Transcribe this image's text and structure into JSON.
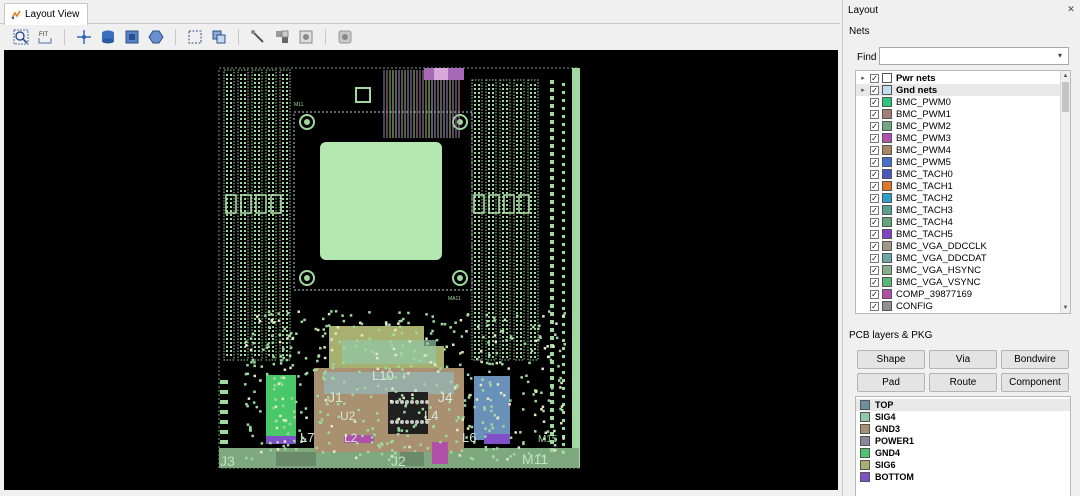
{
  "tab": {
    "label": "Layout View"
  },
  "toolbar": {
    "icons": [
      "zoom-area-icon",
      "zoom-fit-icon",
      "crosshair-icon",
      "cylinder-icon",
      "square-icon",
      "polygon-icon",
      "select-rect-icon",
      "layers-icon",
      "probe-icon",
      "stack-icon",
      "target-icon",
      "record-icon"
    ]
  },
  "board": {
    "labels": [
      "J3",
      "J2",
      "M11",
      "M11",
      "MA11",
      "J1",
      "J4",
      "L10",
      "L4",
      "L6",
      "L7",
      "L2",
      "U2",
      "M15"
    ]
  },
  "panel": {
    "title": "Layout",
    "close": "✕",
    "nets_title": "Nets",
    "find_label": "Find",
    "find_value": "",
    "find_drop": "▾",
    "nets": [
      {
        "name": "Pwr nets",
        "color": "#ffffff",
        "group": true,
        "checked": "✓",
        "expand": "▸"
      },
      {
        "name": "Gnd nets",
        "color": "#bfdcf0",
        "group": true,
        "checked": "✓",
        "expand": "▸"
      },
      {
        "name": "BMC_PWM0",
        "color": "#28c878",
        "checked": "✓"
      },
      {
        "name": "BMC_PWM1",
        "color": "#a08070",
        "checked": "✓"
      },
      {
        "name": "BMC_PWM2",
        "color": "#70a880",
        "checked": "✓"
      },
      {
        "name": "BMC_PWM3",
        "color": "#b050b0",
        "checked": "✓"
      },
      {
        "name": "BMC_PWM4",
        "color": "#a88860",
        "checked": "✓"
      },
      {
        "name": "BMC_PWM5",
        "color": "#4070d0",
        "checked": "✓"
      },
      {
        "name": "BMC_TACH0",
        "color": "#4858c0",
        "checked": "✓"
      },
      {
        "name": "BMC_TACH1",
        "color": "#e07828",
        "checked": "✓"
      },
      {
        "name": "BMC_TACH2",
        "color": "#28a0c8",
        "checked": "✓"
      },
      {
        "name": "BMC_TACH3",
        "color": "#58a090",
        "checked": "✓"
      },
      {
        "name": "BMC_TACH4",
        "color": "#60a878",
        "checked": "✓"
      },
      {
        "name": "BMC_TACH5",
        "color": "#8040c8",
        "checked": "✓"
      },
      {
        "name": "BMC_VGA_DDCCLK",
        "color": "#a09880",
        "checked": "✓"
      },
      {
        "name": "BMC_VGA_DDCDAT",
        "color": "#68a8a8",
        "checked": "✓"
      },
      {
        "name": "BMC_VGA_HSYNC",
        "color": "#88b088",
        "checked": "✓"
      },
      {
        "name": "BMC_VGA_VSYNC",
        "color": "#58b878",
        "checked": "✓"
      },
      {
        "name": "COMP_39877169",
        "color": "#b050a8",
        "checked": "✓"
      },
      {
        "name": "CONFIG",
        "color": "#909090",
        "checked": "✓"
      }
    ],
    "pcb_title": "PCB layers & PKG",
    "buttons": [
      "Shape",
      "Via",
      "Bondwire",
      "Pad",
      "Route",
      "Component"
    ],
    "layers": [
      {
        "name": "TOP",
        "color": "#6890a0"
      },
      {
        "name": "SIG4",
        "color": "#90c8a8"
      },
      {
        "name": "GND3",
        "color": "#a89070"
      },
      {
        "name": "POWER1",
        "color": "#8888a0"
      },
      {
        "name": "GND4",
        "color": "#48c868"
      },
      {
        "name": "SIG6",
        "color": "#a8b070"
      },
      {
        "name": "BOTTOM",
        "color": "#8050c8"
      }
    ]
  }
}
